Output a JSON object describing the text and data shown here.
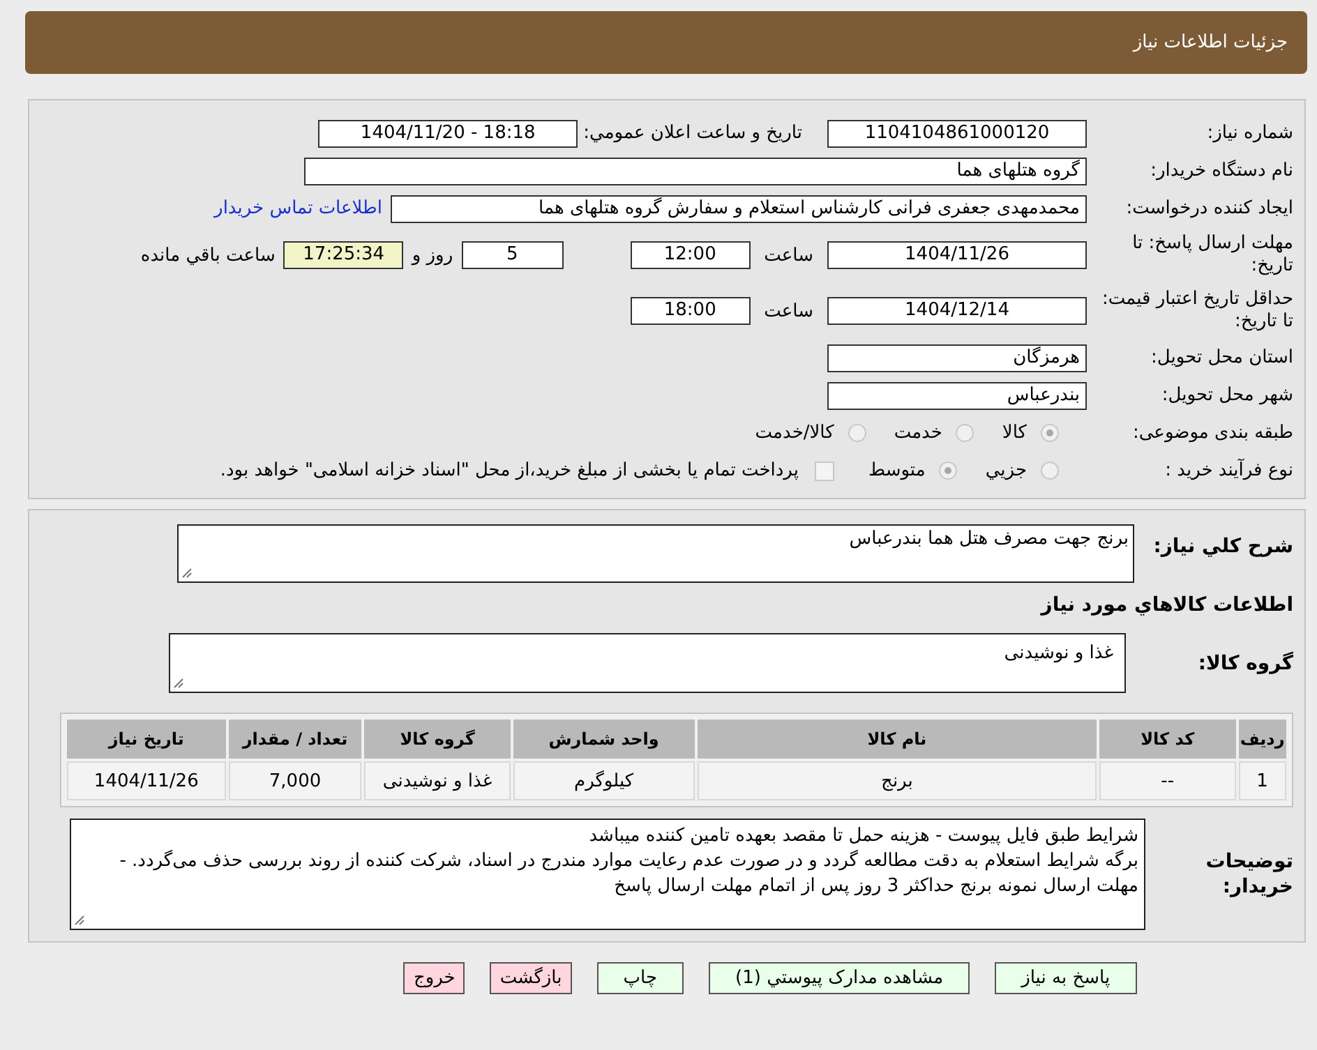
{
  "header": {
    "title": "جزئيات اطلاعات نياز"
  },
  "need_number": {
    "label": "شماره نياز:",
    "value": "1104104861000120"
  },
  "announce": {
    "label": "تاريخ و ساعت اعلان عمومي:",
    "value": "1404/11/20 - 18:18"
  },
  "buyer_org": {
    "label": "نام دستگاه خريدار:",
    "value": "گروه هتلهای هما"
  },
  "requester": {
    "label": "ايجاد کننده درخواست:",
    "value": "محمدمهدی جعفری فرانی کارشناس استعلام و سفارش گروه هتلهای هما",
    "link": "اطلاعات تماس خريدار"
  },
  "deadline": {
    "label": "مهلت ارسال پاسخ: تا تاريخ:",
    "date": "1404/11/26",
    "time_label": "ساعت",
    "time": "12:00",
    "days": "5",
    "days_label": "روز و",
    "remaining": "17:25:34",
    "remaining_label": "ساعت باقي مانده"
  },
  "validity": {
    "label": "حداقل تاريخ اعتبار قيمت: تا تاريخ:",
    "date": "1404/12/14",
    "time_label": "ساعت",
    "time": "18:00"
  },
  "province": {
    "label": "استان محل تحويل:",
    "value": "هرمزگان"
  },
  "city": {
    "label": "شهر محل تحويل:",
    "value": "بندرعباس"
  },
  "category": {
    "label": "طبقه بندی موضوعی:",
    "options": [
      {
        "label": "کالا",
        "selected": true
      },
      {
        "label": "خدمت",
        "selected": false
      },
      {
        "label": "کالا/خدمت",
        "selected": false
      }
    ]
  },
  "process": {
    "label": "نوع فرآيند خريد :",
    "options": [
      {
        "label": "جزيي",
        "selected": false
      },
      {
        "label": "متوسط",
        "selected": true
      }
    ],
    "payment": {
      "checked": false,
      "label": "پرداخت تمام يا بخشی از مبلغ خريد،از محل \"اسناد خزانه اسلامی\" خواهد بود."
    }
  },
  "description": {
    "label": "شرح کلي نياز:",
    "value": "برنج جهت مصرف هتل هما بندرعباس"
  },
  "goods_title": "اطلاعات کالاهاي مورد نياز",
  "goods_group": {
    "label": "گروه کالا:",
    "value": "غذا و نوشیدنی"
  },
  "table": {
    "columns": [
      "رديف",
      "کد کالا",
      "نام کالا",
      "واحد شمارش",
      "گروه کالا",
      "تعداد / مقدار",
      "تاريخ نياز"
    ],
    "rows": [
      [
        "1",
        "--",
        "برنج",
        "کیلوگرم",
        "غذا و نوشیدنی",
        "7,000",
        "1404/11/26"
      ]
    ]
  },
  "notes": {
    "label": "توضيحات خريدار:",
    "value": "شرایط طبق فایل پیوست - هزینه حمل تا مقصد بعهده تامین کننده میباشد\nبرگه شرایط استعلام به دقت مطالعه گردد و در صورت عدم رعایت موارد مندرج در اسناد، شرکت کننده از روند بررسی حذف می‌گردد. - مهلت ارسال نمونه برنج حداکثر 3 روز پس از اتمام مهلت ارسال پاسخ"
  },
  "buttons": [
    {
      "label": "پاسخ به نياز",
      "kind": "action"
    },
    {
      "label": "مشاهده مدارک پيوستي (1)",
      "kind": "action"
    },
    {
      "label": "چاپ",
      "kind": "action"
    },
    {
      "label": "بازگشت",
      "kind": "exit"
    },
    {
      "label": "خروج",
      "kind": "exit"
    }
  ]
}
